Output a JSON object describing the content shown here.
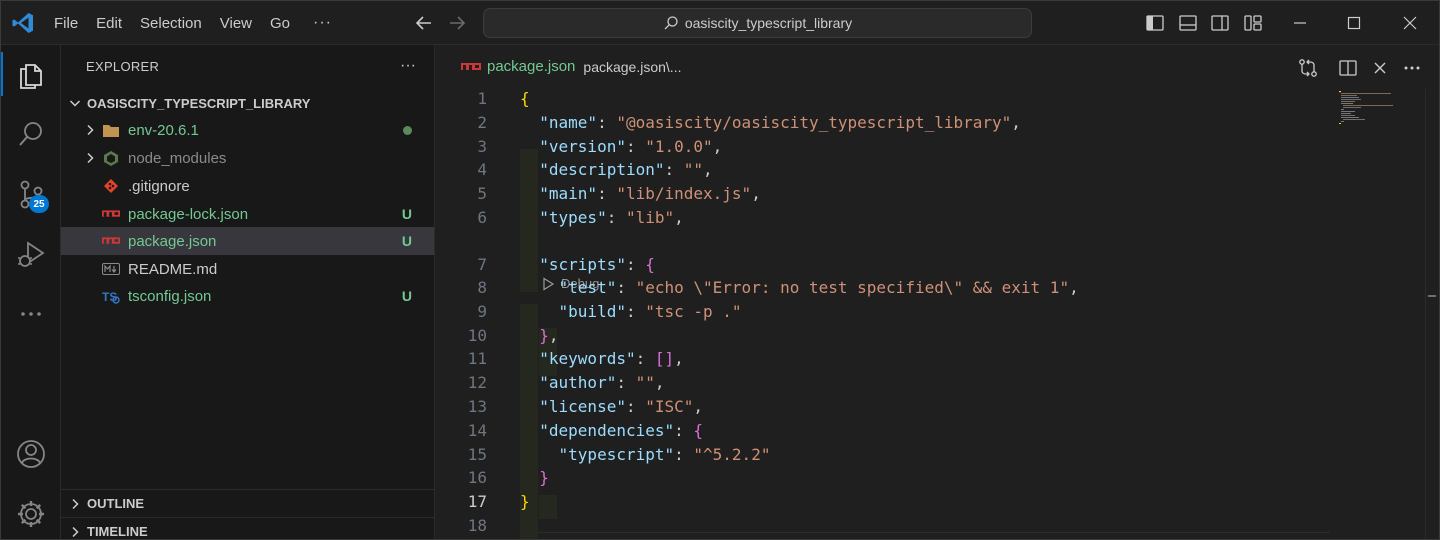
{
  "menu": {
    "file": "File",
    "edit": "Edit",
    "selection": "Selection",
    "view": "View",
    "go": "Go",
    "more": "···"
  },
  "search": {
    "text": "oasiscity_typescript_library"
  },
  "activity_bar": {
    "source_control_badge": "25"
  },
  "explorer": {
    "title": "EXPLORER",
    "more": "···",
    "folder": "OASISCITY_TYPESCRIPT_LIBRARY",
    "items": [
      {
        "label": "env-20.6.1",
        "icon": "folder-icon",
        "color": "#73c991",
        "status": ""
      },
      {
        "label": "node_modules",
        "icon": "node-modules-folder-icon",
        "color": "#8b8b8b",
        "status": ""
      },
      {
        "label": ".gitignore",
        "icon": "git-icon",
        "color": "#cccccc",
        "status": ""
      },
      {
        "label": "package-lock.json",
        "icon": "npm-icon",
        "color": "#73c991",
        "status": "U"
      },
      {
        "label": "package.json",
        "icon": "npm-icon",
        "color": "#73c991",
        "status": "U"
      },
      {
        "label": "README.md",
        "icon": "markdown-icon",
        "color": "#cccccc",
        "status": ""
      },
      {
        "label": "tsconfig.json",
        "icon": "typescript-icon",
        "color": "#73c991",
        "status": "U"
      }
    ],
    "outline": "OUTLINE",
    "timeline": "TIMELINE"
  },
  "editor": {
    "tab_file": "package.json",
    "breadcrumb_path": "package.json\\...",
    "codelens": "Debug",
    "line_numbers": [
      "1",
      "2",
      "3",
      "4",
      "5",
      "6",
      "7",
      "8",
      "9",
      "10",
      "11",
      "12",
      "13",
      "14",
      "15",
      "16",
      "17",
      "18"
    ],
    "lines": [
      {
        "indent": "",
        "key": "",
        "value": "",
        "open": "{",
        "open_class": "b1",
        "close": "",
        "comma": ""
      },
      {
        "indent": "  ",
        "key": "\"name\"",
        "value": "\"@oasiscity/oasiscity_typescript_library\"",
        "comma": ","
      },
      {
        "indent": "  ",
        "key": "\"version\"",
        "value": "\"1.0.0\"",
        "comma": ","
      },
      {
        "indent": "  ",
        "key": "\"description\"",
        "value": "\"\"",
        "comma": ","
      },
      {
        "indent": "  ",
        "key": "\"main\"",
        "value": "\"lib/index.js\"",
        "comma": ","
      },
      {
        "indent": "  ",
        "key": "\"types\"",
        "value": "\"lib\"",
        "comma": ","
      },
      {
        "indent": "  ",
        "key": "\"scripts\"",
        "value": "",
        "open": "{",
        "open_class": "b2",
        "comma": ""
      },
      {
        "indent": "    ",
        "key": "\"test\"",
        "value": "\"echo \\\"Error: no test specified\\\" && exit 1\"",
        "comma": ","
      },
      {
        "indent": "    ",
        "key": "\"build\"",
        "value": "\"tsc -p .\"",
        "comma": ""
      },
      {
        "indent": "  ",
        "key": "",
        "value": "",
        "close": "}",
        "close_class": "b2",
        "comma": ","
      },
      {
        "indent": "  ",
        "key": "\"keywords\"",
        "value": "",
        "open": "[]",
        "open_class": "b2",
        "comma": ","
      },
      {
        "indent": "  ",
        "key": "\"author\"",
        "value": "\"\"",
        "comma": ","
      },
      {
        "indent": "  ",
        "key": "\"license\"",
        "value": "\"ISC\"",
        "comma": ","
      },
      {
        "indent": "  ",
        "key": "\"dependencies\"",
        "value": "",
        "open": "{",
        "open_class": "b2",
        "comma": ""
      },
      {
        "indent": "    ",
        "key": "\"typescript\"",
        "value": "\"^5.2.2\"",
        "comma": ""
      },
      {
        "indent": "  ",
        "key": "",
        "value": "",
        "close": "}",
        "close_class": "b2",
        "comma": ""
      },
      {
        "indent": "",
        "key": "",
        "value": "",
        "close": "}",
        "close_class": "b1",
        "comma": ""
      },
      {
        "indent": "",
        "key": "",
        "value": "",
        "comma": ""
      }
    ]
  },
  "colors": {
    "accent": "#0078d4",
    "untracked": "#73c991",
    "string": "#ce9178",
    "key": "#9cdcfe"
  }
}
